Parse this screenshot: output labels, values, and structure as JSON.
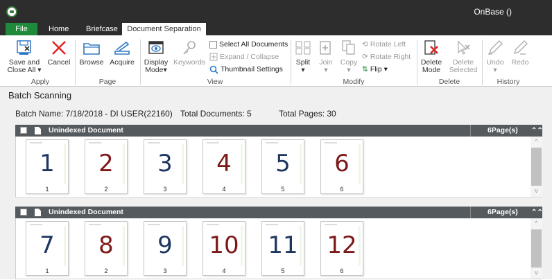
{
  "app": {
    "title": "OnBase ()"
  },
  "tabs": [
    {
      "label": "File"
    },
    {
      "label": "Home"
    },
    {
      "label": "Briefcase"
    },
    {
      "label": "Document Separation"
    }
  ],
  "ribbon": {
    "apply": {
      "group_label": "Apply",
      "save_close_line1": "Save and",
      "save_close_line2": "Close All",
      "cancel": "Cancel"
    },
    "page": {
      "group_label": "Page",
      "browse": "Browse",
      "acquire": "Acquire"
    },
    "view": {
      "group_label": "View",
      "display_mode_line1": "Display",
      "display_mode_line2": "Mode",
      "keywords": "Keywords",
      "select_all": "Select All Documents",
      "expand_collapse": "Expand / Collapse",
      "thumbnail_settings": "Thumbnail Settings"
    },
    "modify": {
      "group_label": "Modify",
      "split": "Split",
      "join": "Join",
      "copy": "Copy",
      "rotate_left": "Rotate Left",
      "rotate_right": "Rotate Right",
      "flip": "Flip"
    },
    "delete": {
      "group_label": "Delete",
      "delete_mode_line1": "Delete",
      "delete_mode_line2": "Mode",
      "delete_selected_line1": "Delete",
      "delete_selected_line2": "Selected"
    },
    "history": {
      "group_label": "History",
      "undo": "Undo",
      "redo": "Redo"
    }
  },
  "main": {
    "section_title": "Batch Scanning",
    "batch_name": "Batch Name: 7/18/2018 - DI USER(22160)",
    "total_documents": "Total Documents: 5",
    "total_pages": "Total Pages: 30"
  },
  "documents": [
    {
      "title": "Unindexed Document",
      "pages_label": "6Page(s)",
      "pages": [
        {
          "big": "1",
          "small": "1",
          "color": "blue"
        },
        {
          "big": "2",
          "small": "2",
          "color": "red"
        },
        {
          "big": "3",
          "small": "3",
          "color": "blue"
        },
        {
          "big": "4",
          "small": "4",
          "color": "red"
        },
        {
          "big": "5",
          "small": "5",
          "color": "blue"
        },
        {
          "big": "6",
          "small": "6",
          "color": "red"
        }
      ]
    },
    {
      "title": "Unindexed Document",
      "pages_label": "6Page(s)",
      "pages": [
        {
          "big": "7",
          "small": "1",
          "color": "blue"
        },
        {
          "big": "8",
          "small": "2",
          "color": "red"
        },
        {
          "big": "9",
          "small": "3",
          "color": "blue"
        },
        {
          "big": "10",
          "small": "4",
          "color": "red"
        },
        {
          "big": "11",
          "small": "5",
          "color": "blue"
        },
        {
          "big": "12",
          "small": "6",
          "color": "red"
        }
      ]
    }
  ],
  "colors": {
    "file_tab": "#1f8a3a",
    "titlebar": "#2d2d2d",
    "ribbon_accent": "#2f78c4",
    "cancel_red": "#e02020",
    "page_blue": "#1d3660",
    "page_red": "#7d1818",
    "panel_header": "#555a5e"
  }
}
